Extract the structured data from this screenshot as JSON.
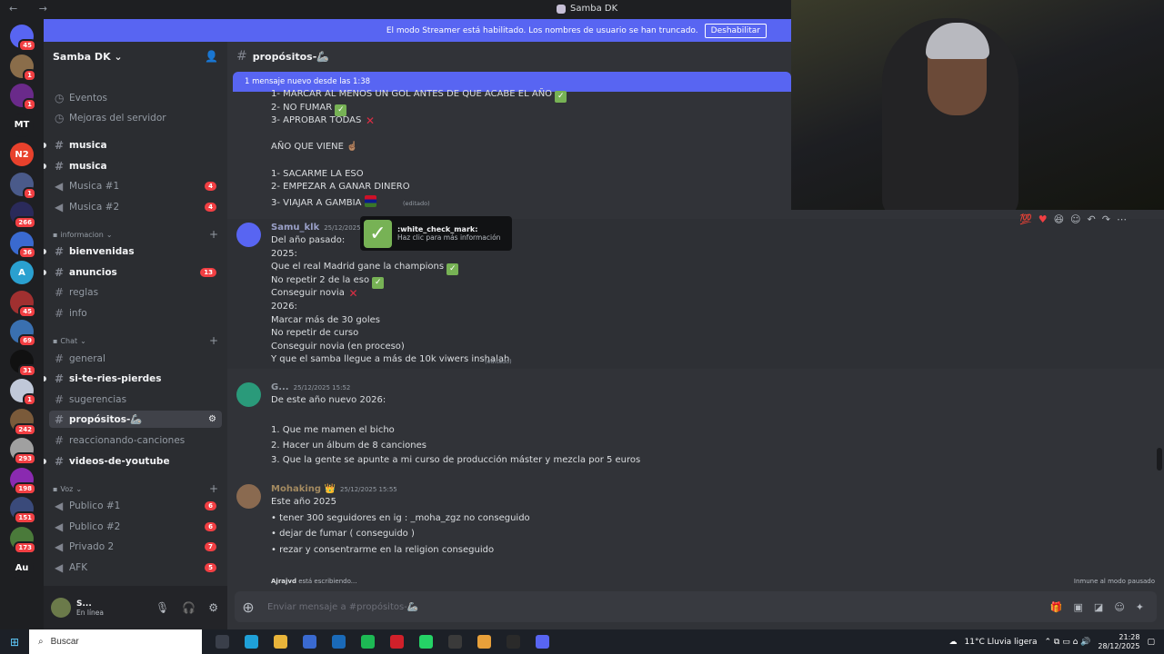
{
  "window": {
    "title": "Samba DK"
  },
  "banner": {
    "text": "El modo Streamer está habilitado. Los nombres de usuario se han truncado.",
    "button": "Deshabilitar"
  },
  "server": {
    "name": "Samba DK ⌄"
  },
  "guilds": [
    {
      "label": "",
      "badge": "45",
      "color": "#5865f2"
    },
    {
      "label": "",
      "badge": "1",
      "color": "#8a6d4a"
    },
    {
      "label": "",
      "badge": "1",
      "color": "#6a2a8a"
    },
    {
      "label": "MT",
      "badge": "",
      "color": "#1e1f22"
    },
    {
      "label": "N2",
      "badge": "",
      "color": "#e8412c"
    },
    {
      "label": "",
      "badge": "1",
      "color": "#4a5a8a"
    },
    {
      "label": "",
      "badge": "266",
      "color": "#2a2a5a"
    },
    {
      "label": "",
      "badge": "36",
      "color": "#3a6ad0"
    },
    {
      "label": "A",
      "badge": "",
      "color": "#2aa0d0"
    },
    {
      "label": "",
      "badge": "45",
      "color": "#a03030"
    },
    {
      "label": "",
      "badge": "69",
      "color": "#3a70b0"
    },
    {
      "label": "",
      "badge": "31",
      "color": "#111"
    },
    {
      "label": "",
      "badge": "1",
      "color": "#c0c8d8"
    },
    {
      "label": "",
      "badge": "242",
      "color": "#7a5a3a"
    },
    {
      "label": "",
      "badge": "293",
      "color": "#a0a0a0"
    },
    {
      "label": "",
      "badge": "198",
      "color": "#8a2ab0"
    },
    {
      "label": "",
      "badge": "151",
      "color": "#3a4a7a"
    },
    {
      "label": "",
      "badge": "173",
      "color": "#4a7a3a"
    },
    {
      "label": "Au",
      "badge": "",
      "color": "#1e1f22"
    }
  ],
  "sidebar": {
    "top": [
      {
        "label": "Eventos",
        "icon": "calendar-icon"
      },
      {
        "label": "Mejoras del servidor",
        "icon": "boost-icon"
      }
    ],
    "cats": [
      "informacion",
      "Chat",
      "Voz"
    ],
    "channels": [
      {
        "label": "musica",
        "unread": true
      },
      {
        "label": "musica",
        "unread": true
      },
      {
        "label": "Musica #1",
        "badge": "4",
        "voice": true
      },
      {
        "label": "Musica #2",
        "badge": "4",
        "voice": true
      },
      {
        "label": "bienvenidas",
        "unread": true
      },
      {
        "label": "anuncios",
        "unread": true,
        "badge": "13"
      },
      {
        "label": "reglas"
      },
      {
        "label": "info"
      },
      {
        "label": "general"
      },
      {
        "label": "si-te-ries-pierdes",
        "unread": true
      },
      {
        "label": "sugerencias"
      },
      {
        "label": "propósitos-🦾",
        "active": true
      },
      {
        "label": "reaccionando-canciones"
      },
      {
        "label": "videos-de-youtube",
        "unread": true
      },
      {
        "label": "Publico #1",
        "badge": "6",
        "voice": true
      },
      {
        "label": "Publico #2",
        "badge": "6",
        "voice": true
      },
      {
        "label": "Privado 2",
        "badge": "7",
        "voice": true
      },
      {
        "label": "AFK",
        "badge": "5",
        "voice": true
      }
    ],
    "user": {
      "name": "S...",
      "status": "En línea"
    }
  },
  "channel": {
    "name": "propósitos-🦾",
    "newbar": "1 mensaje nuevo desde las 1:38"
  },
  "msg1": {
    "lines": [
      "1- MARCAR AL MENOS UN GOL ANTES DE QUE ACABE EL AÑO",
      "2- NO FUMAR",
      "3- APROBAR TODAS",
      "",
      "AÑO QUE VIENE ☝🏽",
      "",
      "1- SACARME LA ESO",
      "2- EMPEZAR A GANAR DINERO",
      "3- VIAJAR A GAMBIA"
    ],
    "edited": "(editado)"
  },
  "msg2": {
    "author": "Samu_klk",
    "time": "25/12/2025",
    "lines": [
      "Del año pasado:",
      "2025:",
      "Que el real Madrid gane la champions",
      "No repetir 2 de la eso",
      "Conseguir novia",
      "2026:",
      "Marcar más de 30 goles",
      "No repetir de curso",
      "Conseguir novia (en proceso)",
      "Y que el samba llegue a más de 10k viwers inshalah"
    ],
    "edited": "(editado)"
  },
  "tooltip": {
    "name": ":white_check_mark:",
    "sub": "Haz clic para más información"
  },
  "msg3": {
    "author": "G...",
    "time": "25/12/2025 15:52",
    "lines": [
      "De este año nuevo 2026:",
      "",
      "1. Que me mamen el bicho",
      "2. Hacer un álbum de 8 canciones",
      "3. Que la gente se apunte a mi curso de producción máster y mezcla por 5 euros"
    ]
  },
  "msg4": {
    "author": "Mohaking 👑",
    "time": "25/12/2025 15:55",
    "lines": [
      "Este año 2025",
      "•  tener 300 seguidores en  ig : _moha_zgz no conseguido",
      "•  dejar de fumar ( conseguido )",
      "•  rezar y consentrarme en la religion conseguido"
    ]
  },
  "typing": {
    "user": "Ajrajvd",
    "text": " está escribiendo..."
  },
  "immune": "Inmune al modo pausado",
  "composer": {
    "placeholder": "Enviar mensaje a #propósitos-🦾"
  },
  "taskbar": {
    "search": "Buscar",
    "weather": "11°C  Lluvia ligera",
    "time": "21:28",
    "date": "28/12/2025"
  }
}
